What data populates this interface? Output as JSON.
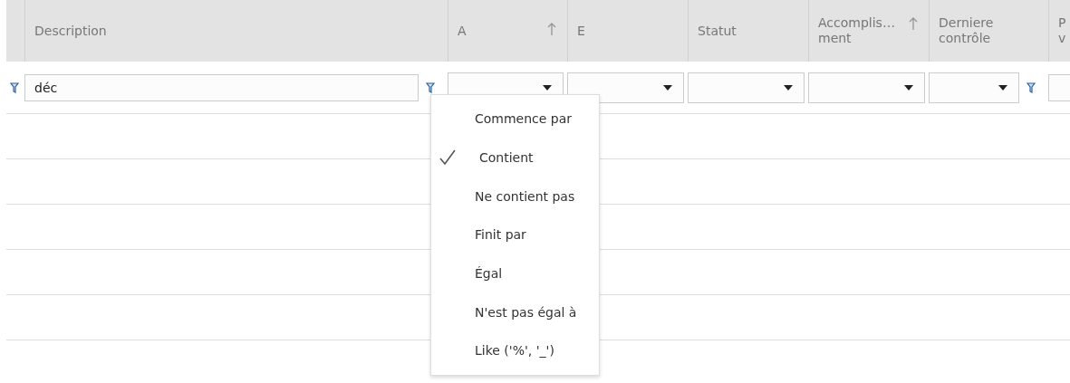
{
  "columns": [
    {
      "lines": [
        "Description"
      ],
      "sorted": false
    },
    {
      "lines": [
        "A"
      ],
      "sorted": true
    },
    {
      "lines": [
        "E"
      ],
      "sorted": false
    },
    {
      "lines": [
        "Statut"
      ],
      "sorted": false
    },
    {
      "lines": [
        "Accomplis…",
        "ment"
      ],
      "sorted": true
    },
    {
      "lines": [
        "Derniere",
        "contrôle"
      ],
      "sorted": false
    },
    {
      "lines": [
        "P",
        "v"
      ]
    }
  ],
  "filters": [
    {
      "kind": "text",
      "value": "déc",
      "filter_icon": true
    },
    {
      "kind": "dropdown",
      "filter_icon": false
    },
    {
      "kind": "dropdown",
      "filter_icon": false
    },
    {
      "kind": "dropdown",
      "filter_icon": false
    },
    {
      "kind": "dropdown",
      "filter_icon": false
    },
    {
      "kind": "dropdown",
      "filter_icon": true
    },
    {
      "kind": "text"
    }
  ],
  "filter_menu": [
    {
      "label": "Commence par",
      "selected": false
    },
    {
      "label": "Contient",
      "selected": true
    },
    {
      "label": "Ne contient pas",
      "selected": false
    },
    {
      "label": "Finit par",
      "selected": false
    },
    {
      "label": "Égal",
      "selected": false
    },
    {
      "label": "N'est pas égal à",
      "selected": false
    },
    {
      "label": "Like ('%', '_')",
      "selected": false
    }
  ]
}
